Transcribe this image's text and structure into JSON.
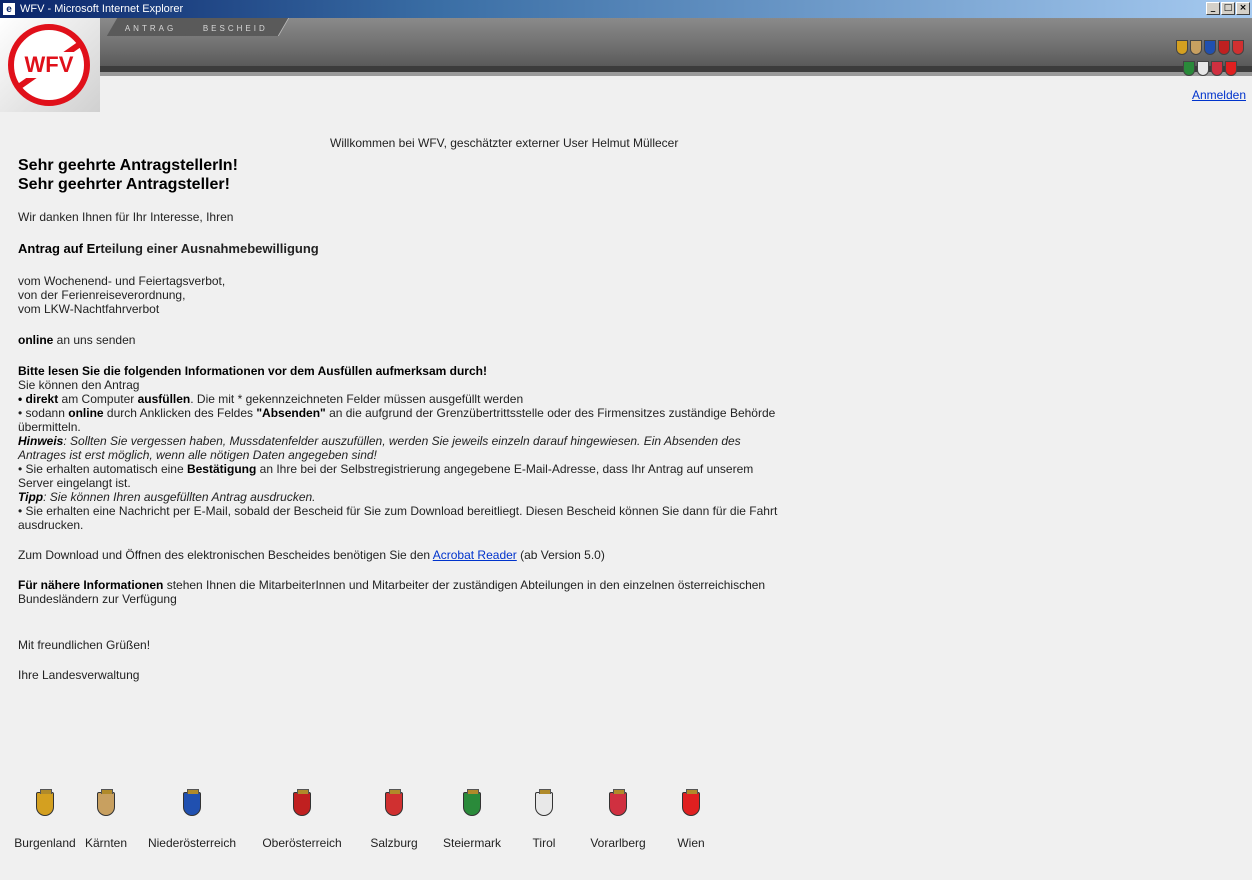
{
  "window": {
    "title": "WFV - Microsoft Internet Explorer",
    "btn_min": "_",
    "btn_max": "□",
    "btn_close": "×"
  },
  "header": {
    "logo_text": "WFV",
    "nav": [
      {
        "label": "ANTRAG"
      },
      {
        "label": "BESCHEID"
      }
    ],
    "login_link": "Anmelden"
  },
  "welcome": "Willkommen bei WFV, geschätzter externer User Helmut Müllecer",
  "content": {
    "greeting1": "Sehr geehrte AntragstellerIn!",
    "greeting2": "Sehr geehrter Antragsteller!",
    "thanks": "Wir danken Ihnen für Ihr Interesse, Ihren",
    "antrag_a": "Antrag auf Er",
    "antrag_b": "teilung einer Ausnahmebewilligung",
    "item1": "vom Wochenend- und Feiertagsverbot,",
    "item2": "von der Ferienreiseverordnung,",
    "item3": "vom LKW-Nachtfahrverbot",
    "online_bold": "online",
    "online_rest": " an uns senden",
    "bitte": "Bitte lesen Sie die folgenden Informationen vor dem Ausfüllen aufmerksam durch!",
    "koennen": "Sie können den Antrag",
    "b1_bold1": "• direkt",
    "b1_mid": " am Computer ",
    "b1_bold2": "ausfüllen",
    "b1_rest": ". Die mit * gekennzeichneten Felder müssen ausgefüllt werden",
    "b2_pre": "• sodann ",
    "b2_bold": "online",
    "b2_mid": " durch Anklicken des Feldes ",
    "b2_bold2": "\"Absenden\"",
    "b2_rest": " an die aufgrund der Grenzübertrittsstelle oder des Firmensitzes zuständige Behörde übermitteln.",
    "hinweis_bold": "Hinweis",
    "hinweis_rest": ": Sollten Sie vergessen haben, Mussdatenfelder auszufüllen, werden Sie jeweils einzeln darauf hingewiesen. Ein Absenden des Antrages ist erst möglich, wenn alle nötigen Daten angegeben sind!",
    "b3_pre": "• Sie erhalten automatisch eine ",
    "b3_bold": "Bestätigung",
    "b3_rest": " an Ihre bei der Selbstregistrierung angegebene E-Mail-Adresse, dass Ihr Antrag auf unserem Server eingelangt ist.",
    "tipp_bold": "Tipp",
    "tipp_rest": ": Sie können Ihren ausgefüllten Antrag ausdrucken.",
    "b4": "• Sie erhalten eine Nachricht per E-Mail, sobald der Bescheid für Sie zum Download bereitliegt. Diesen Bescheid können Sie dann für die Fahrt ausdrucken.",
    "download_pre": "Zum Download und Öffnen des elektronischen Bescheides benötigen Sie den ",
    "download_link": "Acrobat Reader",
    "download_rest": " (ab Version 5.0)",
    "info_bold": "Für nähere Informationen",
    "info_rest": " stehen Ihnen die MitarbeiterInnen und Mitarbeiter der zuständigen Abteilungen in den einzelnen österreichischen Bundesländern zur Verfügung",
    "gruesse": "Mit freundlichen Grüßen!",
    "verwaltung": "Ihre Landesverwaltung"
  },
  "states": [
    {
      "name": "Burgenland",
      "color": "#d4a020"
    },
    {
      "name": "Kärnten",
      "color": "#c8a060"
    },
    {
      "name": "Niederösterreich",
      "color": "#2050b0"
    },
    {
      "name": "Oberösterreich",
      "color": "#c02020"
    },
    {
      "name": "Salzburg",
      "color": "#d03030"
    },
    {
      "name": "Steiermark",
      "color": "#2a8a3a"
    },
    {
      "name": "Tirol",
      "color": "#e8e8e8"
    },
    {
      "name": "Vorarlberg",
      "color": "#d03040"
    },
    {
      "name": "Wien",
      "color": "#e02020"
    }
  ]
}
